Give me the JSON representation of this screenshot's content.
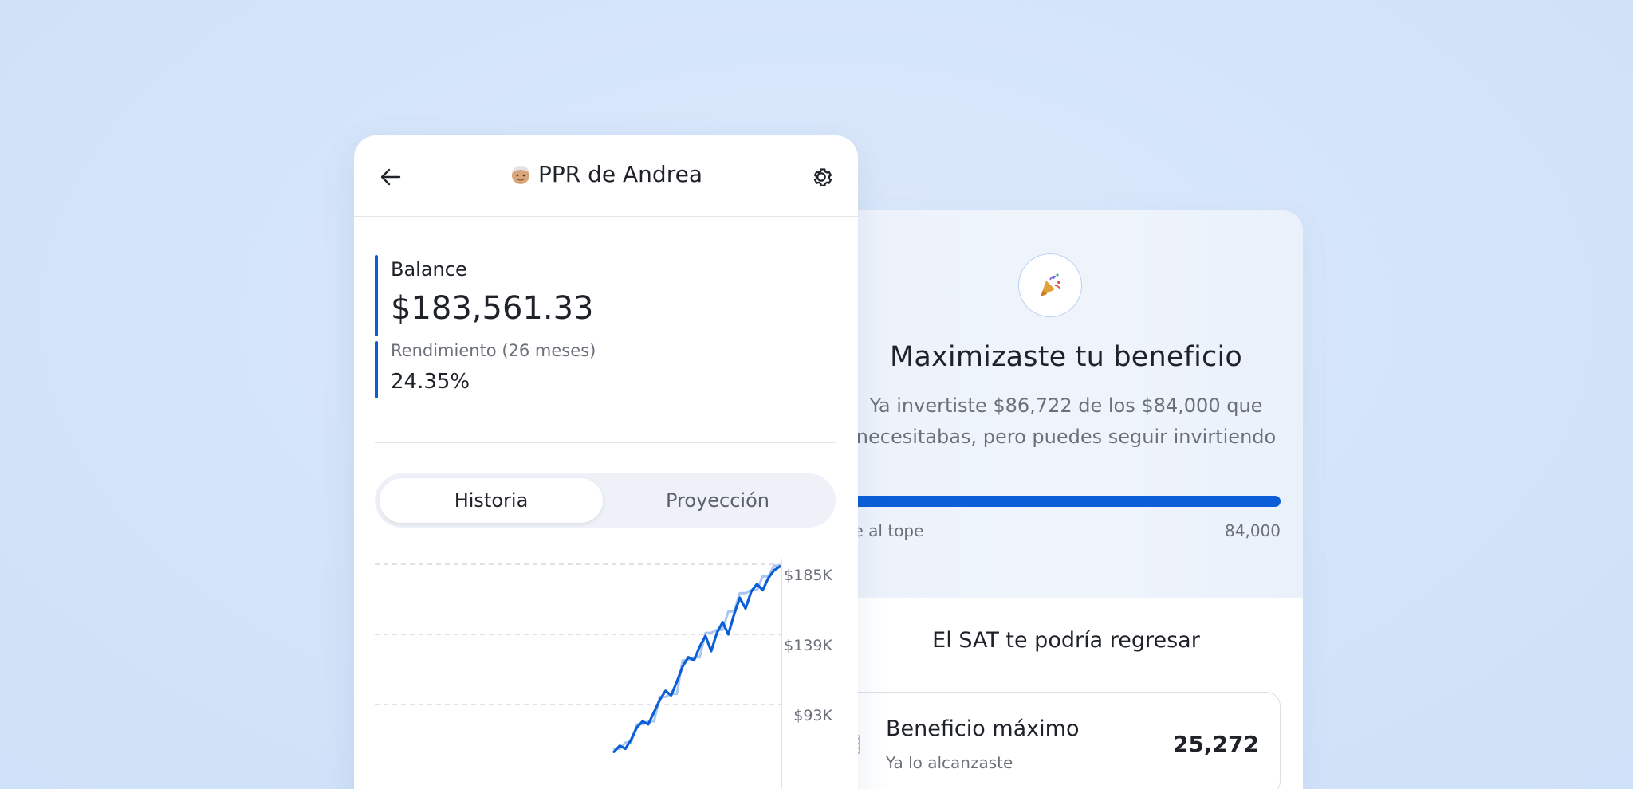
{
  "ppr": {
    "title": "PPR de Andrea",
    "avatar_icon": "older-person-emoji-icon",
    "back_icon": "arrow-left-icon",
    "settings_icon": "gear-icon",
    "balance_label": "Balance",
    "balance_value": "$183,561.33",
    "yield_label": "Rendimiento (26 meses)",
    "yield_value": "24.35%",
    "tabs": [
      {
        "label": "Historia",
        "active": true
      },
      {
        "label": "Proyección",
        "active": false
      }
    ]
  },
  "benefit": {
    "icon": "party-popper-icon",
    "title": "Maximizaste tu beneficio",
    "description": "Ya invertiste $86,722 de los $84,000 que necesitabas, pero puedes seguir invirtiendo",
    "progress_fraction": 1.0,
    "progress_left_label": "aste al tope",
    "progress_right_label": "84,000",
    "sat_title": "El SAT te podría regresar",
    "max_label": "Beneficio máximo",
    "max_sub": "Ya lo alcanzaste",
    "max_value": "25,272",
    "max_icon": "coins-icon"
  },
  "colors": {
    "accent": "#0b5ed7",
    "background": "#d6e6fa",
    "projection_line": "#a9c6ee"
  },
  "chart_data": {
    "type": "line",
    "y_ticks": [
      "$185K",
      "$139K",
      "$93K"
    ],
    "y_tick_values": [
      185000,
      139000,
      93000
    ],
    "ylim": [
      75000,
      190000
    ],
    "grid": true,
    "series": [
      {
        "values": [
          62000,
          66000,
          64000,
          70000,
          78000,
          82000,
          80000,
          88000,
          96000,
          102000,
          99000,
          108000,
          118000,
          124000,
          122000,
          131000,
          138000,
          128000,
          140000,
          147000,
          139000,
          152000,
          163000,
          156000,
          167000,
          172000,
          168000,
          176000,
          181000,
          183561
        ]
      },
      {
        "values": [
          64000,
          64000,
          68000,
          68000,
          80000,
          80000,
          82000,
          82000,
          98000,
          98000,
          100000,
          100000,
          122000,
          122000,
          124000,
          124000,
          140000,
          140000,
          142000,
          142000,
          154000,
          154000,
          166000,
          166000,
          168000,
          168000,
          177000,
          177000,
          184000,
          184000
        ]
      }
    ]
  }
}
